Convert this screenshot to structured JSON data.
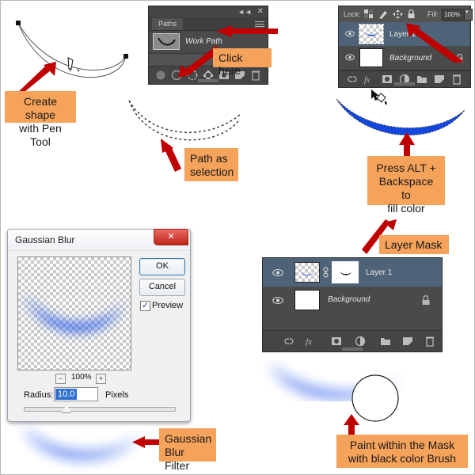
{
  "callouts": [
    {
      "id": "create-shape",
      "text": "Create shape\nwith Pen Tool"
    },
    {
      "id": "click-here",
      "text": "Click here"
    },
    {
      "id": "path-as-selection",
      "text": "Path as\nselection"
    },
    {
      "id": "press-alt-backspace",
      "text": "Press ALT +\nBackspace to\nfill color"
    },
    {
      "id": "gaussian-blur-filter",
      "text": "Gaussian\nBlur Filter"
    },
    {
      "id": "layer-mask",
      "text": "Layer Mask"
    },
    {
      "id": "paint-within-mask",
      "text": "Paint within the Mask\nwith black color Brush"
    }
  ],
  "paths_panel": {
    "tab_label": "Paths",
    "collapse_icon": "collapse-icon",
    "close_icon": "close-icon",
    "menu_icon": "panel-menu-icon",
    "path_name": "Work Path",
    "footer_icons": [
      "fill-path-icon",
      "stroke-path-icon",
      "load-path-as-selection-icon",
      "make-work-path-icon",
      "add-layer-mask-icon",
      "new-path-icon",
      "delete-path-icon"
    ]
  },
  "layers_panel_top": {
    "lock_label": "Lock:",
    "lock_icons": [
      "lock-transparent-pixels-icon",
      "lock-image-pixels-icon",
      "lock-position-icon",
      "lock-all-icon"
    ],
    "fill_label": "Fill:",
    "fill_value": "100%",
    "fill_dropdown_icon": "chevron-down-icon",
    "rows": [
      {
        "name": "Layer 1",
        "selected": true,
        "thumb": "transparent-shape-thumb",
        "locked": false
      },
      {
        "name": "Background",
        "selected": false,
        "thumb": "white-thumb",
        "locked": true
      }
    ]
  },
  "layers_panel_bottom": {
    "rows": [
      {
        "name": "Layer 1",
        "selected": true,
        "thumb": "transparent-shape-thumb",
        "mask": "layer-mask-thumb",
        "locked": false
      },
      {
        "name": "Background",
        "selected": false,
        "thumb": "white-thumb",
        "mask": null,
        "locked": true
      }
    ],
    "footer_icons": [
      "link-layers-icon",
      "layer-style-fx-icon",
      "add-layer-mask-icon",
      "adjustment-layer-icon",
      "new-group-icon",
      "new-layer-icon",
      "delete-layer-icon"
    ]
  },
  "gaussian_dialog": {
    "title": "Gaussian Blur",
    "close_label": "✕",
    "ok_label": "OK",
    "cancel_label": "Cancel",
    "preview_label": "Preview",
    "preview_checked": true,
    "zoom_out_label": "−",
    "zoom_in_label": "+",
    "zoom_value": "100%",
    "radius_label": "Radius:",
    "radius_value": "10.0",
    "units_label": "Pixels"
  },
  "colors": {
    "callout_bg": "#f5a25a",
    "arrow_red": "#c00000",
    "shape_blue": "#1347dd",
    "panel_bg": "#535353",
    "row_selected": "#4f6378"
  }
}
